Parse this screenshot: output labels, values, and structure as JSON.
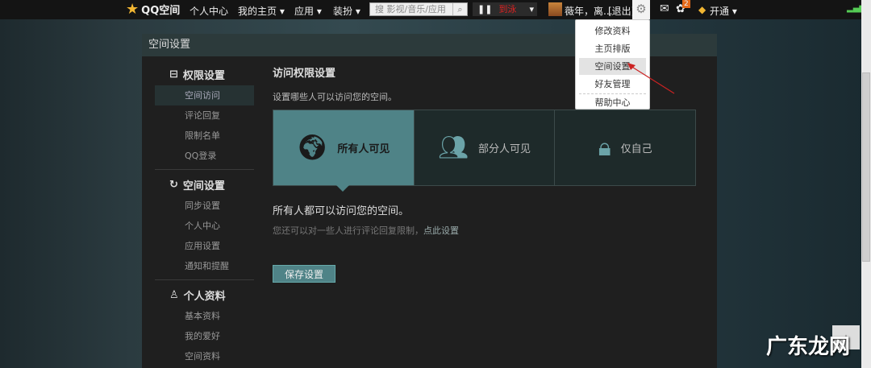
{
  "topbar": {
    "logo": "QQ空间",
    "nav": [
      "个人中心",
      "我的主页 ▾",
      "应用 ▾",
      "装扮 ▾"
    ],
    "search_placeholder": "搜 影视/音乐/应用",
    "music": "到泳",
    "user": "薇年，离...",
    "logout": "[退出]",
    "badge": "2",
    "vip": "开通 ▾"
  },
  "settings_menu": [
    "修改资料",
    "主页排版",
    "空间设置",
    "好友管理",
    "帮助中心"
  ],
  "panel": {
    "title": "空间设置"
  },
  "sidebar": {
    "groups": [
      {
        "title": "权限设置",
        "items": [
          "空间访问",
          "评论回复",
          "限制名单",
          "QQ登录"
        ]
      },
      {
        "title": "空间设置",
        "items": [
          "同步设置",
          "个人中心",
          "应用设置",
          "通知和提醒"
        ]
      },
      {
        "title": "个人资料",
        "items": [
          "基本资料",
          "我的爱好",
          "空间资料"
        ]
      }
    ]
  },
  "content": {
    "title": "访问权限设置",
    "desc": "设置哪些人可以访问您的空间。",
    "options": [
      "所有人可见",
      "部分人可见",
      "仅自己"
    ],
    "message": "所有人都可以访问您的空间。",
    "hint": "您还可以对一些人进行评论回复限制，",
    "hint_link": "点此设置",
    "save": "保存设置"
  },
  "watermark": "广东龙网"
}
